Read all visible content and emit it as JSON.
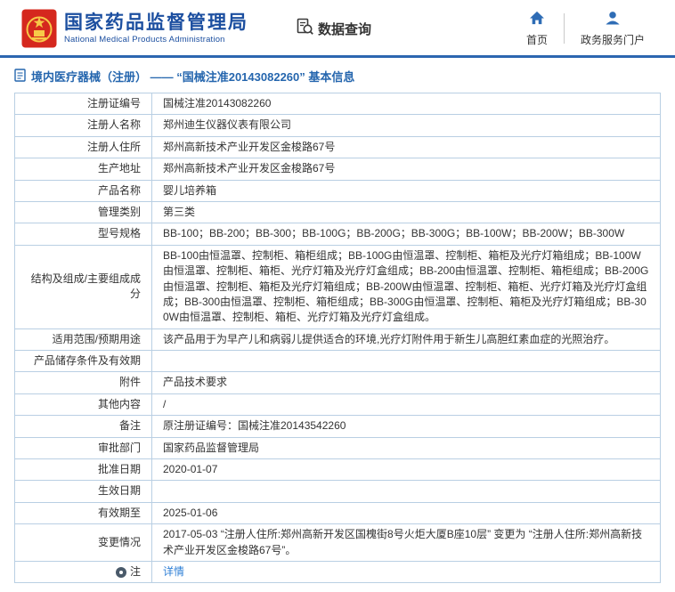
{
  "colors": {
    "brand_blue": "#1c4fa0",
    "header_line_blue": "#2c66b0",
    "table_border": "#b9cfe3",
    "link_blue": "#2e7fd6",
    "emblem_red": "#d5281e",
    "emblem_gold": "#f7c948"
  },
  "header": {
    "org_name_cn": "国家药品监督管理局",
    "org_name_en": "National Medical Products Administration",
    "data_query_label": "数据查询",
    "nav_home": "首页",
    "nav_portal": "政务服务门户"
  },
  "breadcrumb": {
    "text": "境内医疗器械（注册） —— “国械注准20143082260” 基本信息"
  },
  "table": {
    "rows": [
      {
        "label": "注册证编号",
        "value": "国械注准20143082260"
      },
      {
        "label": "注册人名称",
        "value": "郑州迪生仪器仪表有限公司"
      },
      {
        "label": "注册人住所",
        "value": "郑州高新技术产业开发区金梭路67号"
      },
      {
        "label": "生产地址",
        "value": "郑州高新技术产业开发区金梭路67号"
      },
      {
        "label": "产品名称",
        "value": "婴儿培养箱"
      },
      {
        "label": "管理类别",
        "value": "第三类"
      },
      {
        "label": "型号规格",
        "value": "BB-100；BB-200；BB-300；BB-100G；BB-200G；BB-300G；BB-100W；BB-200W；BB-300W"
      },
      {
        "label": "结构及组成/主要组成成分",
        "value": "BB-100由恒温罩、控制柜、箱柜组成；BB-100G由恒温罩、控制柜、箱柜及光疗灯箱组成；BB-100W由恒温罩、控制柜、箱柜、光疗灯箱及光疗灯盒组成；BB-200由恒温罩、控制柜、箱柜组成；BB-200G由恒温罩、控制柜、箱柜及光疗灯箱组成；BB-200W由恒温罩、控制柜、箱柜、光疗灯箱及光疗灯盒组成；BB-300由恒温罩、控制柜、箱柜组成；BB-300G由恒温罩、控制柜、箱柜及光疗灯箱组成；BB-300W由恒温罩、控制柜、箱柜、光疗灯箱及光疗灯盒组成。"
      },
      {
        "label": "适用范围/预期用途",
        "value": "该产品用于为早产儿和病弱儿提供适合的环境,光疗灯附件用于新生儿高胆红素血症的光照治疗。"
      },
      {
        "label": "产品储存条件及有效期",
        "value": ""
      },
      {
        "label": "附件",
        "value": "产品技术要求"
      },
      {
        "label": "其他内容",
        "value": "/"
      },
      {
        "label": "备注",
        "value": "原注册证编号：国械注准20143542260"
      },
      {
        "label": "审批部门",
        "value": "国家药品监督管理局"
      },
      {
        "label": "批准日期",
        "value": "2020-01-07"
      },
      {
        "label": "生效日期",
        "value": ""
      },
      {
        "label": "有效期至",
        "value": "2025-01-06"
      },
      {
        "label": "变更情况",
        "value": "2017-05-03 “注册人住所:郑州高新开发区国槐街8号火炬大厦B座10层” 变更为 “注册人住所:郑州高新技术产业开发区金梭路67号”。"
      }
    ]
  },
  "note_row": {
    "label": "注",
    "link_label": "详情"
  }
}
